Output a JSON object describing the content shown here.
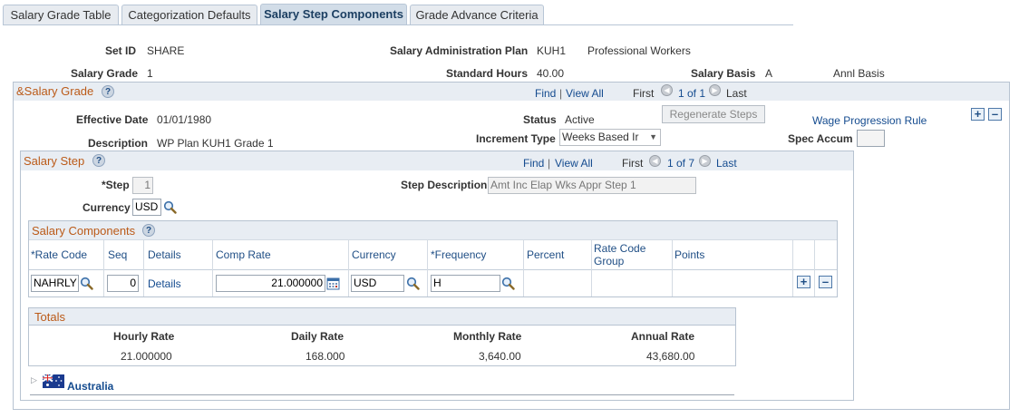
{
  "tabs": [
    "Salary Grade Table",
    "Categorization Defaults",
    "Salary Step Components",
    "Grade Advance Criteria"
  ],
  "header": {
    "set_id_label": "Set ID",
    "set_id": "SHARE",
    "plan_label": "Salary Administration Plan",
    "plan_code": "KUH1",
    "plan_desc": "Professional Workers",
    "grade_label": "Salary Grade",
    "grade": "1",
    "hours_label": "Standard Hours",
    "hours": "40.00",
    "basis_label": "Salary Basis",
    "basis_code": "A",
    "basis_desc": "Annl Basis"
  },
  "salary_grade": {
    "title": "&Salary Grade",
    "find": "Find",
    "view_all": "View All",
    "first": "First",
    "count": "1 of 1",
    "last": "Last",
    "eff_date_label": "Effective Date",
    "eff_date": "01/01/1980",
    "status_label": "Status",
    "status": "Active",
    "regen_button": "Regenerate Steps",
    "wage_link": "Wage Progression Rule",
    "desc_label": "Description",
    "desc": "WP Plan KUH1 Grade 1",
    "incr_label": "Increment Type",
    "incr_value": "Weeks Based Ir",
    "spec_accum_label": "Spec Accum"
  },
  "salary_step": {
    "title": "Salary Step",
    "find": "Find",
    "view_all": "View All",
    "first": "First",
    "count": "1 of 7",
    "last": "Last",
    "step_label": "*Step",
    "step": "1",
    "step_desc_label": "Step Description",
    "step_desc": "Amt Inc Elap Wks Appr Step 1",
    "currency_label": "Currency",
    "currency": "USD"
  },
  "components": {
    "title": "Salary Components",
    "columns": [
      "*Rate Code",
      "Seq",
      "Details",
      "Comp Rate",
      "Currency",
      "*Frequency",
      "Percent",
      "Rate Code Group",
      "Points"
    ],
    "row": {
      "rate_code": "NAHRLY",
      "seq": "0",
      "details": "Details",
      "comp_rate": "21.000000",
      "currency": "USD",
      "frequency": "H"
    }
  },
  "totals": {
    "title": "Totals",
    "hourly_label": "Hourly Rate",
    "hourly": "21.000000",
    "daily_label": "Daily Rate",
    "daily": "168.000",
    "monthly_label": "Monthly Rate",
    "monthly": "3,640.00",
    "annual_label": "Annual Rate",
    "annual": "43,680.00"
  },
  "country": {
    "name": "Australia"
  },
  "icons": [
    "help-icon",
    "magnifier-icon",
    "calendar-icon",
    "prev-arrow-icon",
    "next-arrow-icon",
    "add-row-icon",
    "delete-row-icon",
    "collapse-triangle-icon",
    "australia-flag-icon"
  ]
}
